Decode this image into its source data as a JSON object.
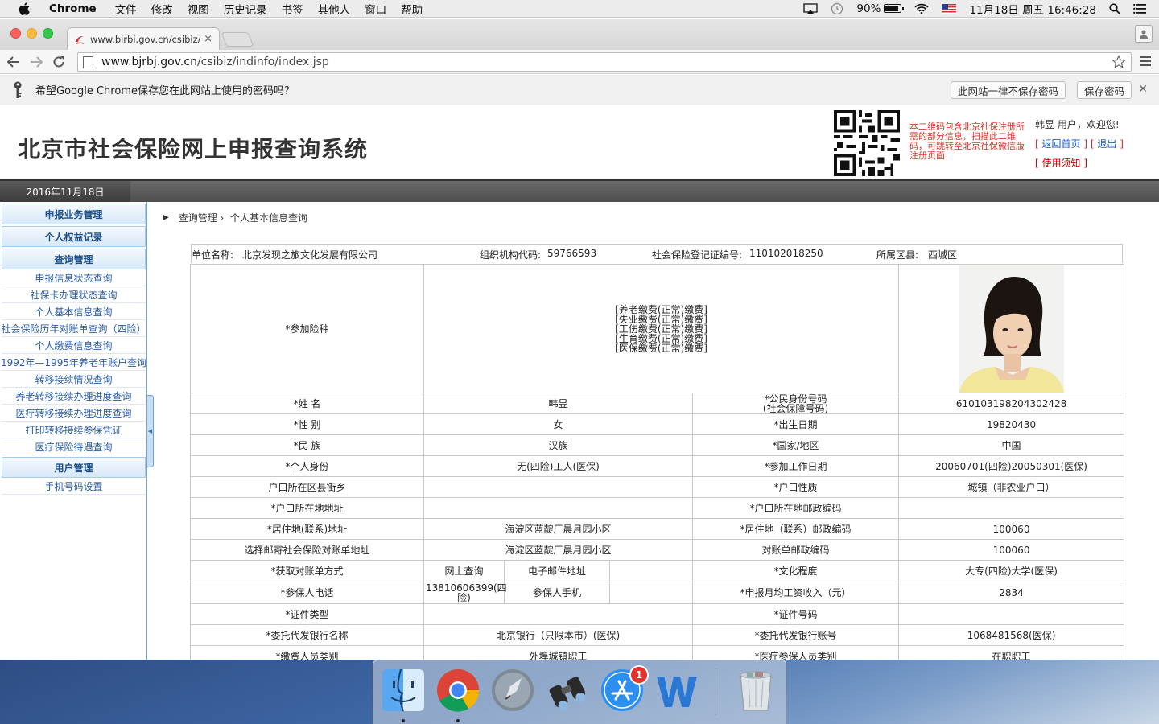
{
  "menubar": {
    "app": "Chrome",
    "items": [
      "文件",
      "修改",
      "视图",
      "历史记录",
      "书签",
      "其他人",
      "窗口",
      "帮助"
    ],
    "battery": "90%",
    "datetime": "11月18日 周五  16:46:28"
  },
  "browser": {
    "tab_title": "www.birbi.gov.cn/csibiz/in",
    "url_host": "www.bjrbj.gov.cn",
    "url_path": "/csibiz/indinfo/index.jsp",
    "password_prompt": "希望Google Chrome保存您在此网站上使用的密码吗?",
    "never_save": "此网站一律不保存密码",
    "save_password": "保存密码"
  },
  "site": {
    "title": "北京市社会保险网上申报查询系统",
    "qr_text": "本二维码包含北京社保注册所需的部分信息，扫描此二维码，可跳转至北京社保微信版注册页面",
    "welcome": "韩昱 用户，欢迎您!",
    "link_home": "返回首页",
    "link_logout": "退出",
    "link_notice": "使用须知",
    "date": "2016年11月18日"
  },
  "sidebar": {
    "groups": [
      {
        "label": "申报业务管理",
        "items": []
      },
      {
        "label": "个人权益记录",
        "items": []
      },
      {
        "label": "查询管理",
        "items": [
          "申报信息状态查询",
          "社保卡办理状态查询",
          "个人基本信息查询",
          "社会保险历年对账单查询（四险）",
          "个人缴费信息查询",
          "1992年—1995年养老年账户查询",
          "转移接续情况查询",
          "养老转移接续办理进度查询",
          "医疗转移接续办理进度查询",
          "打印转移接续参保凭证",
          "医疗保险待遇查询"
        ]
      },
      {
        "label": "用户管理",
        "items": [
          "手机号码设置"
        ]
      }
    ]
  },
  "breadcrumb": {
    "parent": "查询管理 ›",
    "current": "个人基本信息查询"
  },
  "info": {
    "unit_label": "单位名称:",
    "unit": "北京发现之旅文化发展有限公司",
    "org_label": "组织机构代码:",
    "org": "59766593",
    "reg_label": "社会保险登记证编号:",
    "reg": "110102018250",
    "district_label": "所属区县:",
    "district": "西城区"
  },
  "table": {
    "insurance_label": "*参加险种",
    "insurance_types": [
      "[养老缴费(正常)缴费]",
      "[失业缴费(正常)缴费]",
      "[工伤缴费(正常)缴费]",
      "[生育缴费(正常)缴费]",
      "[医保缴费(正常)缴费]"
    ],
    "rows": [
      {
        "l1": "*姓 名",
        "v1": "韩昱",
        "l2": "*公民身份号码\n(社会保障号码)",
        "v2": "610103198204302428"
      },
      {
        "l1": "*性 别",
        "v1": "女",
        "l2": "*出生日期",
        "v2": "19820430"
      },
      {
        "l1": "*民 族",
        "v1": "汉族",
        "l2": "*国家/地区",
        "v2": "中国"
      },
      {
        "l1": "*个人身份",
        "v1": "无(四险)工人(医保)",
        "l2": "*参加工作日期",
        "v2": "20060701(四险)20050301(医保)"
      },
      {
        "l1": "户口所在区县街乡",
        "v1": "",
        "l2": "*户口性质",
        "v2": "城镇（非农业户口）"
      },
      {
        "l1": "*户口所在地地址",
        "v1": "",
        "l2": "*户口所在地邮政编码",
        "v2": ""
      },
      {
        "l1": "*居住地(联系)地址",
        "v1": "海淀区蓝靛厂晨月园小区",
        "l2": "*居住地（联系）邮政编码",
        "v2": "100060"
      },
      {
        "l1": "选择邮寄社会保险对账单地址",
        "v1": "海淀区蓝靛厂晨月园小区",
        "l2": "对账单邮政编码",
        "v2": "100060"
      }
    ],
    "bill_method_label": "*获取对账单方式",
    "bill_method": "网上查询",
    "email_label": "电子邮件地址",
    "email": "",
    "education_label": "*文化程度",
    "education": "大专(四险)大学(医保)",
    "phone_label": "*参保人电话",
    "phone": "13810606399(四险)",
    "mobile_label": "参保人手机",
    "mobile": "",
    "income_label": "*申报月均工资收入（元）",
    "income": "2834",
    "rows2": [
      {
        "l1": "*证件类型",
        "v1": "",
        "l2": "*证件号码",
        "v2": ""
      },
      {
        "l1": "*委托代发银行名称",
        "v1": "北京银行（只限本市）(医保)",
        "l2": "*委托代发银行账号",
        "v2": "1068481568(医保)"
      },
      {
        "l1": "*缴费人员类别",
        "v1": "外埠城镇职工",
        "l2": "*医疗参保人员类别",
        "v2": "在职职工"
      }
    ]
  },
  "dock": {
    "appstore_badge": "1"
  }
}
